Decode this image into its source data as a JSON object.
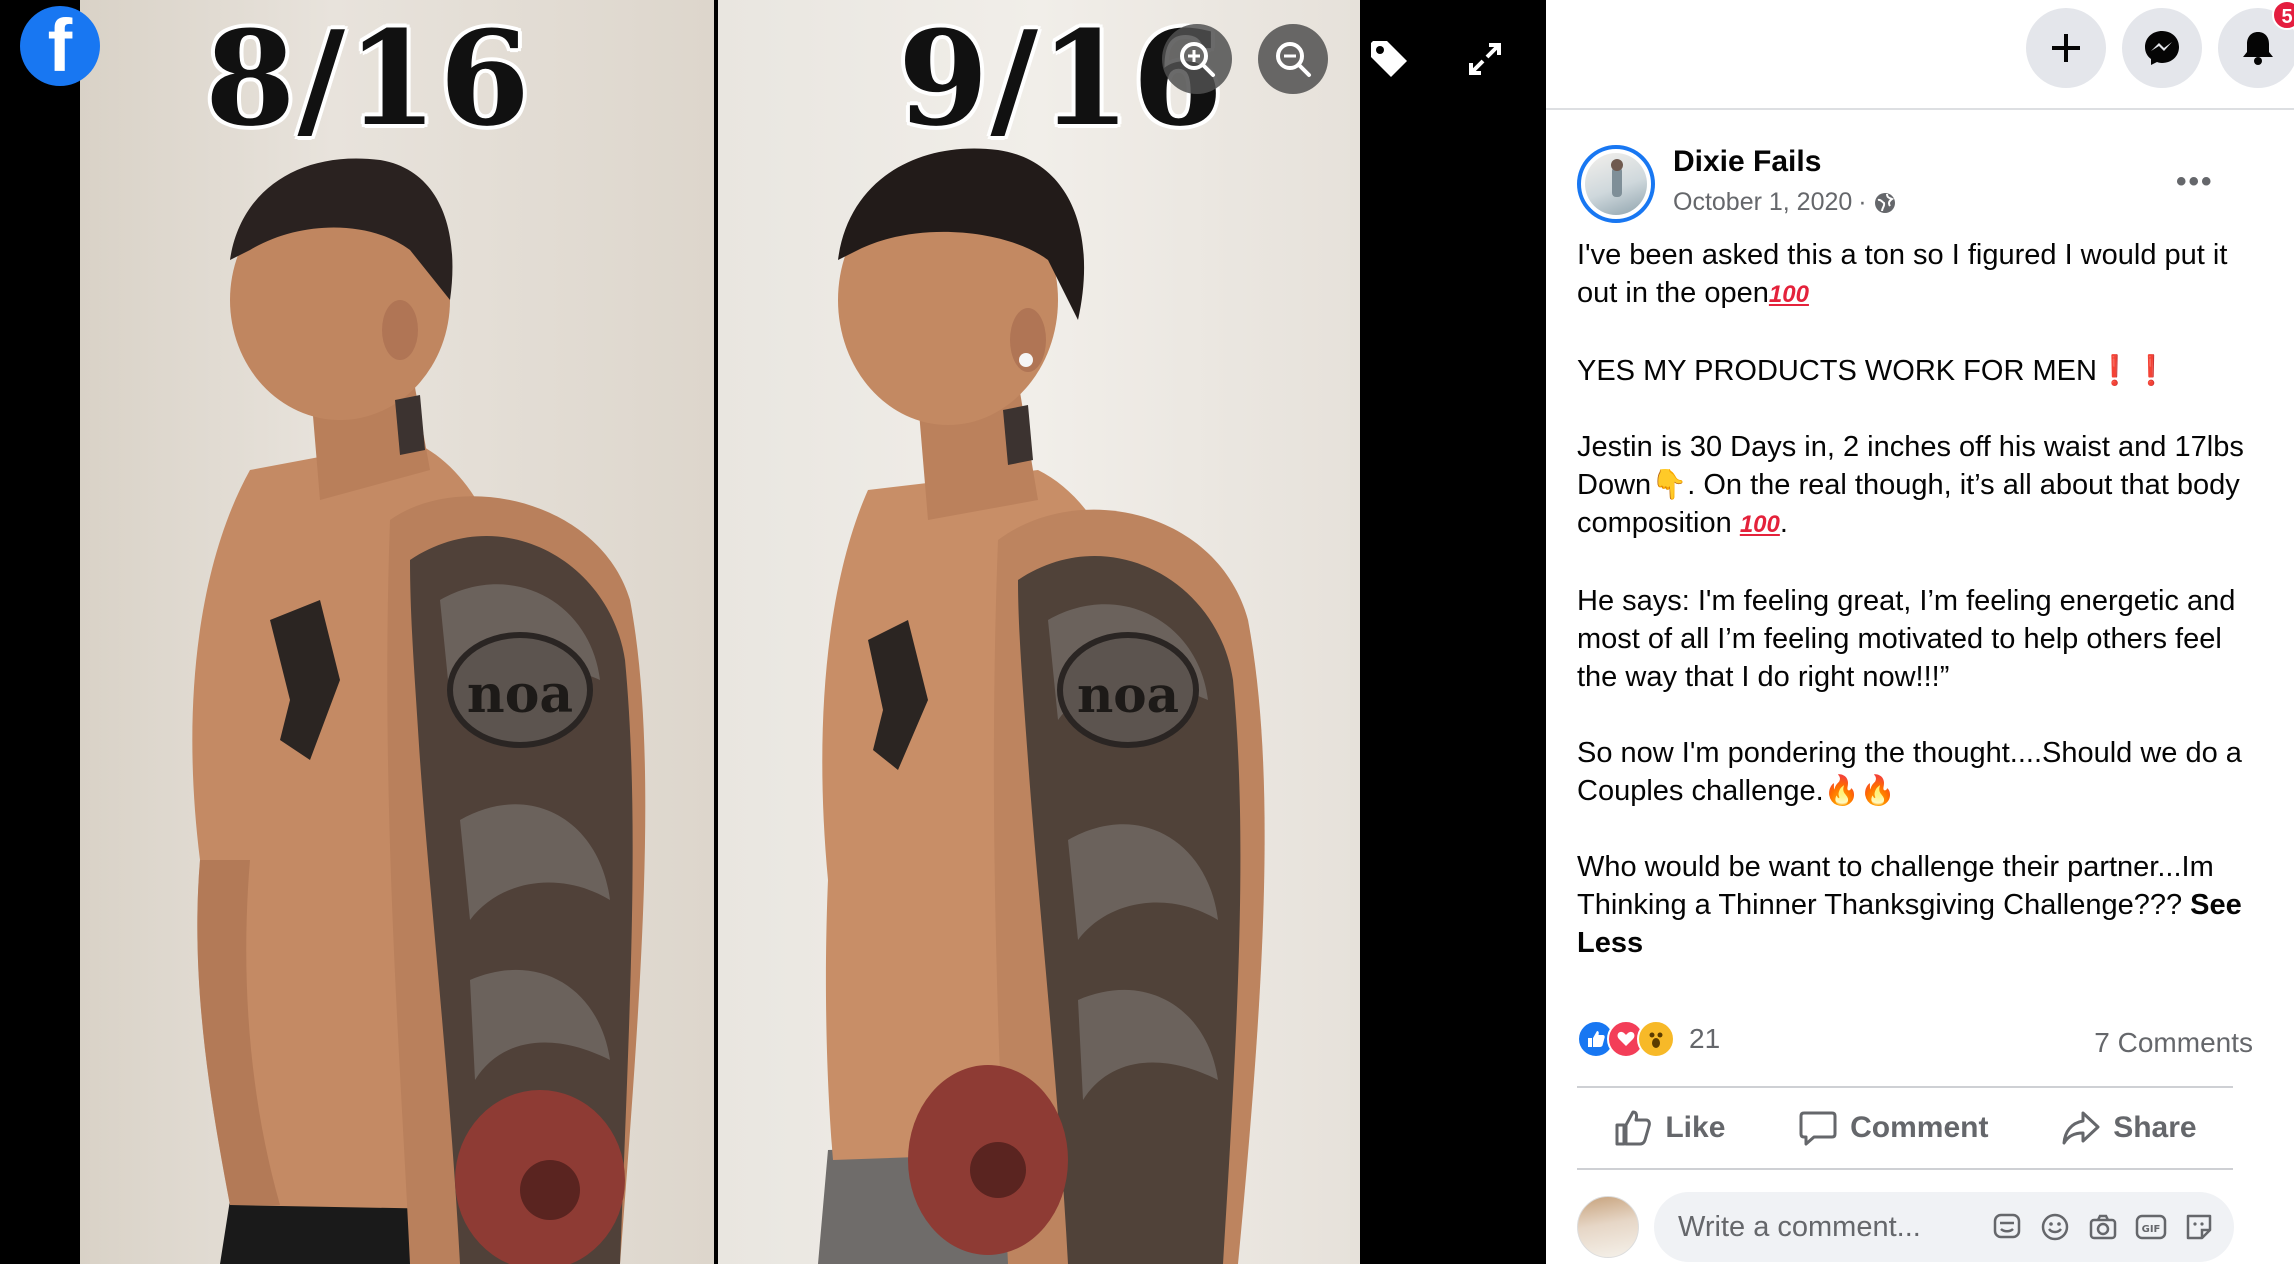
{
  "viewer": {
    "logo": "f",
    "before_label": "8/16",
    "after_label": "9/16",
    "tattoo_text": "noa",
    "controls": {
      "zoom_in_icon": "zoom-in-icon",
      "zoom_out_icon": "zoom-out-icon",
      "tag_icon": "tag-icon",
      "fullscreen_icon": "expand-icon"
    }
  },
  "topbar": {
    "create_icon": "plus-icon",
    "messenger_icon": "messenger-icon",
    "notifications_icon": "bell-icon",
    "notifications_badge": "5"
  },
  "post": {
    "author": "Dixie Fails",
    "date": "October 1, 2020",
    "separator": "·",
    "privacy_icon": "globe-icon",
    "more_label": "•••",
    "paragraphs": [
      "I've been asked this a ton so I figured I would put it out in the open",
      "YES MY PRODUCTS WORK FOR MEN",
      "Jestin is 30 Days in, 2 inches off his waist and 17lbs Down",
      ". On the real though, it’s all about that body composition ",
      "He says: I'm feeling great, I’m feeling energetic and most of all I’m feeling motivated to help others feel the way that I do right now!!!”",
      "So now I'm pondering the thought....Should we do a Couples challenge.",
      "Who would be want to challenge their partner...Im Thinking a Thinner Thanksgiving Challenge??? "
    ],
    "emoji_100": "100",
    "emoji_exclaim": "❗❗",
    "emoji_point": "👇",
    "emoji_fire": "🔥🔥",
    "period": ".",
    "see_less": "See Less",
    "reaction_count": "21",
    "comments_count": "7 Comments",
    "actions": {
      "like": "Like",
      "comment": "Comment",
      "share": "Share"
    },
    "comment_placeholder": "Write a comment..."
  },
  "colors": {
    "brand": "#1877f2",
    "badge": "#e41e3f",
    "secondary_text": "#65676b"
  }
}
